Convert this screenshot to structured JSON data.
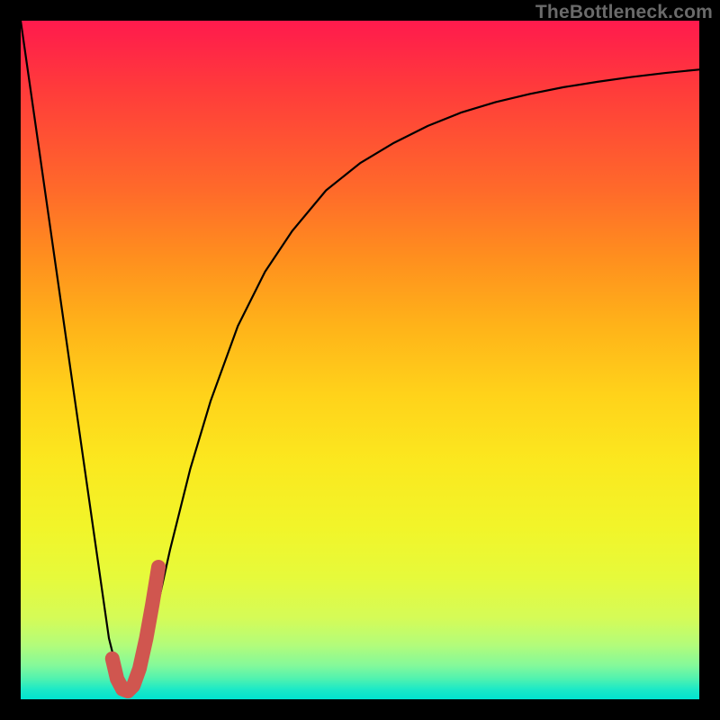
{
  "watermark": "TheBottleneck.com",
  "colors": {
    "frame": "#000000",
    "curve_thin": "#000000",
    "curve_thick": "#d0564f",
    "gradient_top": "#ff1a4d",
    "gradient_bottom": "#00e3d0"
  },
  "chart_data": {
    "type": "line",
    "title": "",
    "xlabel": "",
    "ylabel": "",
    "xlim": [
      0,
      100
    ],
    "ylim": [
      0,
      100
    ],
    "grid": false,
    "series": [
      {
        "name": "bottleneck-curve",
        "x": [
          0,
          2,
          4,
          6,
          8,
          10,
          12,
          13,
          14,
          15,
          16,
          17,
          18,
          20,
          22,
          25,
          28,
          32,
          36,
          40,
          45,
          50,
          55,
          60,
          65,
          70,
          75,
          80,
          85,
          90,
          95,
          100
        ],
        "y": [
          100,
          86,
          72,
          58,
          44,
          30,
          16,
          9,
          5,
          2,
          1,
          2,
          5,
          13,
          22,
          34,
          44,
          55,
          63,
          69,
          75,
          79,
          82,
          84.5,
          86.5,
          88,
          89.2,
          90.2,
          91,
          91.7,
          92.3,
          92.8
        ]
      },
      {
        "name": "highlight-hook",
        "x": [
          13.5,
          14.2,
          15.0,
          15.8,
          16.6,
          17.5,
          18.5,
          19.4,
          20.3
        ],
        "y": [
          6.0,
          3.0,
          1.5,
          1.2,
          2.0,
          4.5,
          9.0,
          14.0,
          19.5
        ]
      }
    ],
    "annotations": [
      {
        "text": "TheBottleneck.com",
        "position": "top-right"
      }
    ]
  }
}
